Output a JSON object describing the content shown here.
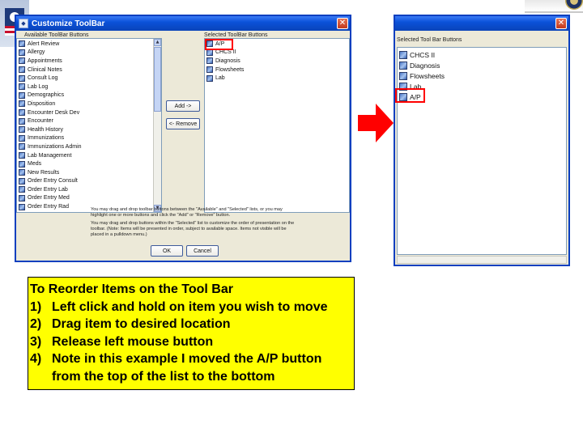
{
  "dialog": {
    "title": "Customize ToolBar",
    "available_label": "Available ToolBar Buttons",
    "selected_label": "Selected ToolBar Buttons",
    "available_items": [
      "Alert Review",
      "Allergy",
      "Appointments",
      "Clinical Notes",
      "Consult Log",
      "Lab Log",
      "Demographics",
      "Disposition",
      "Encounter Desk Dev",
      "Encounter",
      "Health History",
      "Immunizations",
      "Immunizations Admin",
      "Lab Management",
      "Meds",
      "New Results",
      "Order Entry Consult",
      "Order Entry Lab",
      "Order Entry Med",
      "Order Entry Rad"
    ],
    "selected_items": [
      "A/P",
      "CHCS II",
      "Diagnosis",
      "Flowsheets",
      "Lab"
    ],
    "add_button": "Add ->",
    "remove_button": "<- Remove",
    "note_1": "You may drag and drop toolbar buttons between the \"Available\" and \"Selected\" lists, or you may highlight one or more buttons and click the \"Add\" or \"Remove\" button.",
    "note_2": "You may drag and drop buttons within the \"Selected\" list to customize the order of presentation on the toolbar. (Note: Items will be presented in order, subject to available space. Items not visible will be placed in a pulldown menu.)",
    "ok_button": "OK",
    "cancel_button": "Cancel"
  },
  "right_panel": {
    "label": "Selected Tool Bar Buttons",
    "items": [
      "CHCS II",
      "Diagnosis",
      "Flowsheets",
      "Lab",
      "A/P"
    ]
  },
  "instructions": {
    "title": "To Reorder Items on the Tool Bar",
    "steps": [
      {
        "num": "1)",
        "text": "Left click and hold on item you wish to move"
      },
      {
        "num": "2)",
        "text": "Drag item to desired location"
      },
      {
        "num": "3)",
        "text": "Release left mouse button"
      },
      {
        "num": "4)",
        "text": "Note in this example I moved the A/P button from the top of the list to the bottom"
      }
    ]
  },
  "icons": {
    "arrow": "right-arrow-icon",
    "colors": {
      "arrow": "#ff0000",
      "highlight": "#ff0000",
      "instructions_bg": "#ffff00",
      "titlebar": "#0b52d9"
    }
  }
}
